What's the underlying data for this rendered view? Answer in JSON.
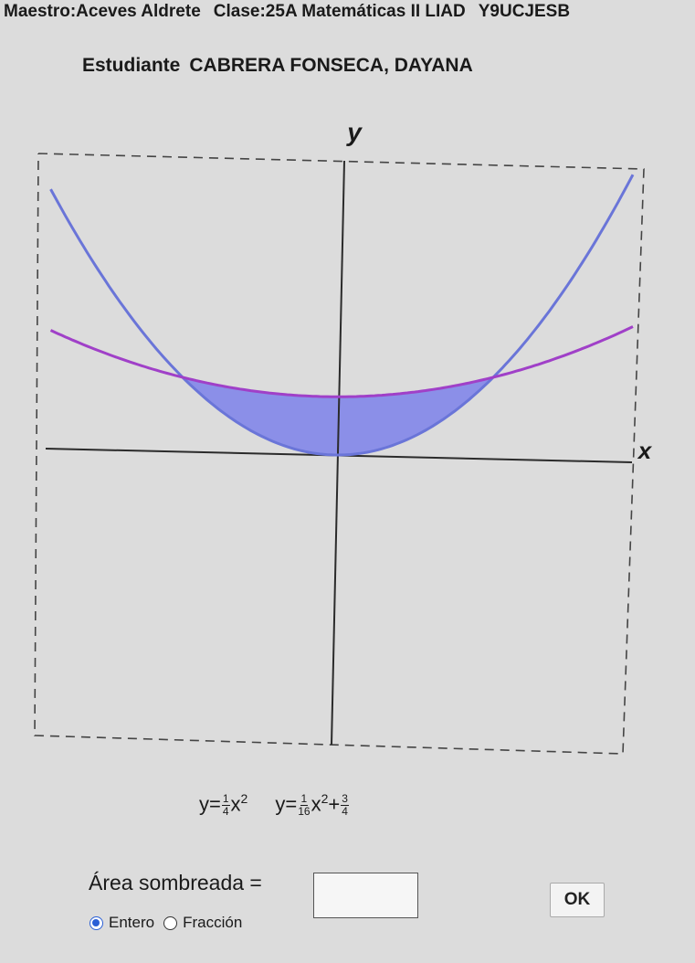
{
  "header": {
    "maestro": "Maestro:Aceves Aldrete",
    "clase": "Clase:25A Matemáticas II LIAD",
    "code": "Y9UCJESB"
  },
  "student": {
    "label": "Estudiante",
    "name": "CABRERA FONSECA, DAYANA"
  },
  "graph": {
    "y_label": "y",
    "x_label": "x",
    "curve1_color": "#6a75d8",
    "curve2_color": "#a040c8",
    "fill_color": "#8b8fe8"
  },
  "equations": {
    "eq1": {
      "lhs": "y=",
      "num": "1",
      "den": "4",
      "var": "x",
      "exp": "2"
    },
    "eq2": {
      "lhs": "y=",
      "num": "1",
      "den": "16",
      "var": "x",
      "exp": "2",
      "plus": "+",
      "cnum": "3",
      "cden": "4"
    }
  },
  "area": {
    "label": "Área sombreada =",
    "value": ""
  },
  "ok_label": "OK",
  "options": {
    "entero": "Entero",
    "fraccion": "Fracción",
    "selected": "entero"
  }
}
